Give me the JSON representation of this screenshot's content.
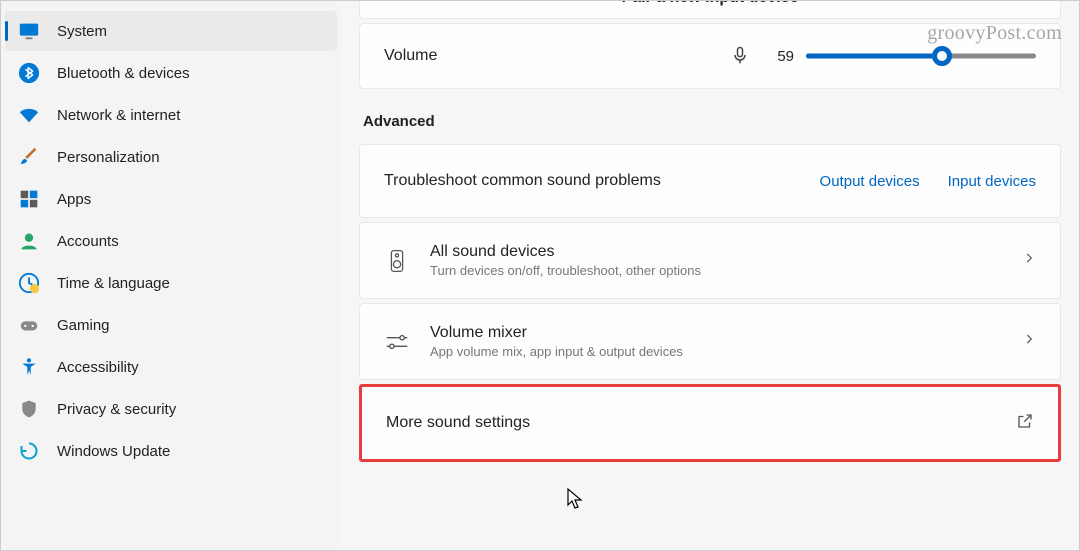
{
  "sidebar": {
    "items": [
      {
        "label": "System"
      },
      {
        "label": "Bluetooth & devices"
      },
      {
        "label": "Network & internet"
      },
      {
        "label": "Personalization"
      },
      {
        "label": "Apps"
      },
      {
        "label": "Accounts"
      },
      {
        "label": "Time & language"
      },
      {
        "label": "Gaming"
      },
      {
        "label": "Accessibility"
      },
      {
        "label": "Privacy & security"
      },
      {
        "label": "Windows Update"
      }
    ]
  },
  "main": {
    "top_peek": "Pair a new input device",
    "volume": {
      "label": "Volume",
      "value": 59
    },
    "advanced_header": "Advanced",
    "troubleshoot": {
      "title": "Troubleshoot common sound problems",
      "output_link": "Output devices",
      "input_link": "Input devices"
    },
    "all_devices": {
      "title": "All sound devices",
      "sub": "Turn devices on/off, troubleshoot, other options"
    },
    "mixer": {
      "title": "Volume mixer",
      "sub": "App volume mix, app input & output devices"
    },
    "more": {
      "title": "More sound settings"
    }
  },
  "watermark": "groovyPost.com"
}
